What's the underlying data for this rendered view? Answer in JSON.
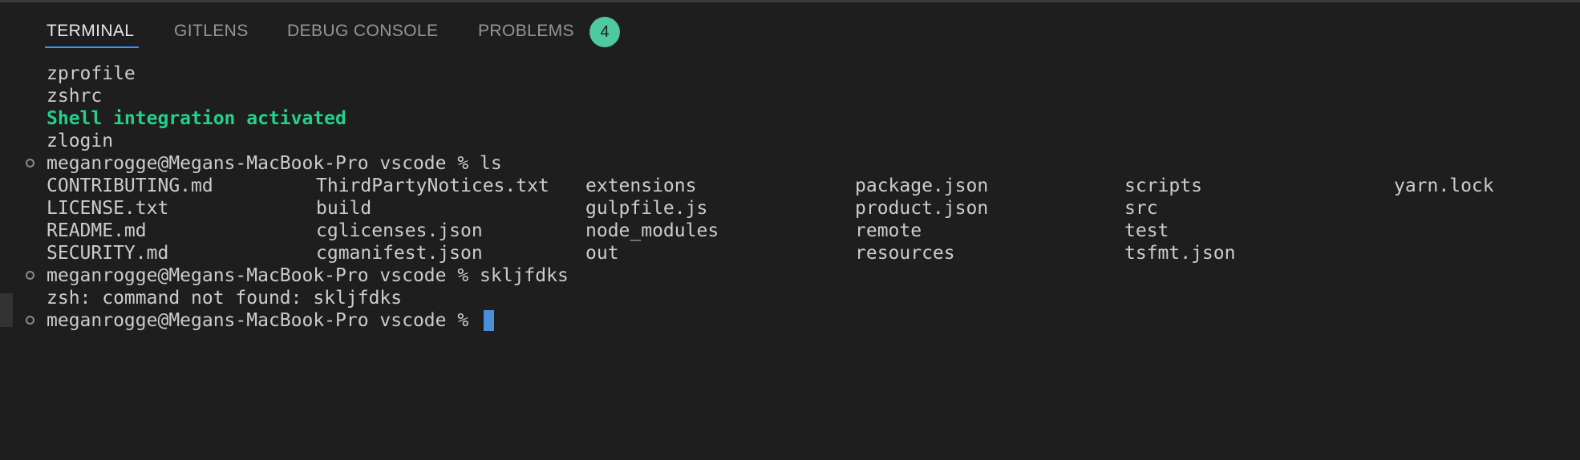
{
  "tabs": [
    {
      "label": "TERMINAL",
      "active": true
    },
    {
      "label": "GITLENS",
      "active": false
    },
    {
      "label": "DEBUG CONSOLE",
      "active": false
    },
    {
      "label": "PROBLEMS",
      "active": false
    }
  ],
  "problems_count": "4",
  "terminal": {
    "startup_lines": [
      "zprofile",
      "zshrc",
      "Shell integration activated",
      "zlogin"
    ],
    "commands": [
      {
        "prompt": "meganrogge@Megans-MacBook-Pro vscode % ls"
      },
      {
        "prompt": "meganrogge@Megans-MacBook-Pro vscode % skljfdks"
      },
      {
        "prompt": "meganrogge@Megans-MacBook-Pro vscode % "
      }
    ],
    "ls_output": [
      [
        "CONTRIBUTING.md",
        "ThirdPartyNotices.txt",
        "extensions",
        "package.json",
        "scripts",
        "yarn.lock"
      ],
      [
        "LICENSE.txt",
        "build",
        "gulpfile.js",
        "product.json",
        "src",
        ""
      ],
      [
        "README.md",
        "cglicenses.json",
        "node_modules",
        "remote",
        "test",
        ""
      ],
      [
        "SECURITY.md",
        "cgmanifest.json",
        "out",
        "resources",
        "tsfmt.json",
        ""
      ]
    ],
    "error_line": "zsh: command not found: skljfdks"
  },
  "colors": {
    "background": "#1e1e1e",
    "active_tab_border": "#3794ff",
    "badge": "#4ec9a0",
    "success_text": "#23d18b",
    "cursor": "#4a90d9"
  }
}
